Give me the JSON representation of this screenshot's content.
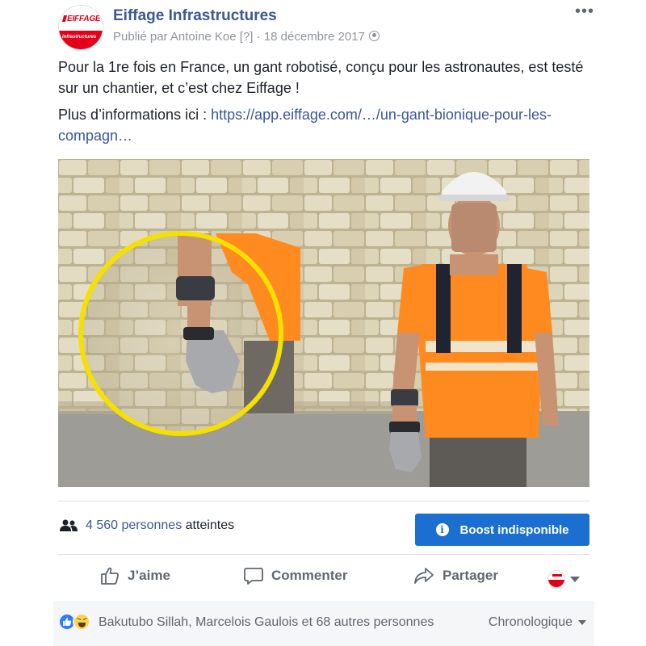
{
  "post": {
    "page_name": "Eiffage Infrastructures",
    "published_by": "Publié par Antoine Koe [?]",
    "separator": " · ",
    "date": "18 décembre 2017",
    "more_icon": "more-dots-icon",
    "privacy_icon": "globe-icon",
    "avatar_logo_text": "EIFFAGE",
    "avatar_logo_subtext": "infrastructures",
    "message_line": "Pour la 1re fois en France, un gant robotisé, conçu pour les astronautes, est testé sur un chantier, et c’est chez Eiffage !",
    "link_prefix": "Plus d’informations ici : ",
    "link_text": "https://app.eiffage.com/…/un-gant-bionique-pour-les-compagn…"
  },
  "stats": {
    "reach_count": "4 560 personnes",
    "reach_suffix": " atteintes",
    "reach_icon": "people-icon",
    "boost_label": "Boost indisponible",
    "boost_icon": "info-icon"
  },
  "actions": {
    "like_label": "J’aime",
    "comment_label": "Commenter",
    "share_label": "Partager"
  },
  "reactions": {
    "names": "Bakutubo Sillah, Marcelois Gaulois et 68 autres personnes",
    "sort_label": "Chronologique",
    "icons": [
      "like-reaction-icon",
      "haha-reaction-icon"
    ]
  },
  "colors": {
    "link": "#385898",
    "boost_bg": "#1b6fd1",
    "brand_red": "#e2001a",
    "vest_orange": "#ff8a1f",
    "highlight_circle": "#f5e000"
  }
}
